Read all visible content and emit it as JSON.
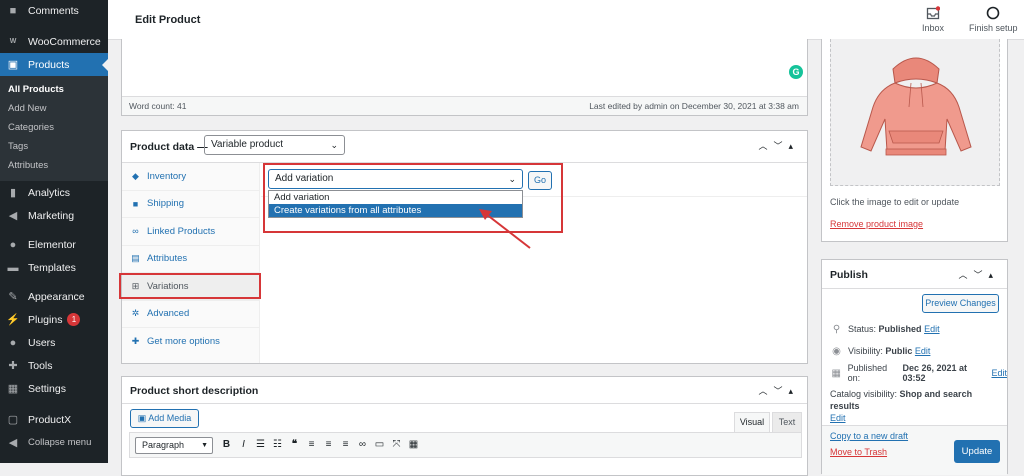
{
  "sidebar": {
    "items": [
      {
        "label": "Comments",
        "icon": "comment-icon"
      },
      {
        "label": "WooCommerce",
        "icon": "woo-icon"
      },
      {
        "label": "Products",
        "icon": "products-icon",
        "active": true
      },
      {
        "label": "Analytics",
        "icon": "chart-icon"
      },
      {
        "label": "Marketing",
        "icon": "megaphone-icon"
      },
      {
        "label": "Elementor",
        "icon": "elementor-icon"
      },
      {
        "label": "Templates",
        "icon": "folder-icon"
      },
      {
        "label": "Appearance",
        "icon": "brush-icon"
      },
      {
        "label": "Plugins",
        "icon": "plug-icon",
        "badge": "1"
      },
      {
        "label": "Users",
        "icon": "user-icon"
      },
      {
        "label": "Tools",
        "icon": "wrench-icon"
      },
      {
        "label": "Settings",
        "icon": "settings-icon"
      },
      {
        "label": "ProductX",
        "icon": "productx-icon"
      },
      {
        "label": "Collapse menu",
        "icon": "collapse-icon"
      }
    ],
    "submenu": [
      "All Products",
      "Add New",
      "Categories",
      "Tags",
      "Attributes"
    ]
  },
  "topbar": {
    "title": "Edit Product",
    "inbox_label": "Inbox",
    "finish_label": "Finish setup"
  },
  "editor": {
    "word_count": "Word count: 41",
    "last_edited": "Last edited by admin on December 30, 2021 at 3:38 am"
  },
  "product_data": {
    "title": "Product data —",
    "type_value": "Variable product",
    "tabs": [
      "Inventory",
      "Shipping",
      "Linked Products",
      "Attributes",
      "Variations",
      "Advanced",
      "Get more options"
    ],
    "variation_select": "Add variation",
    "go_label": "Go",
    "dropdown_options": [
      "Add variation",
      "Create variations from all attributes"
    ]
  },
  "short_desc": {
    "title": "Product short description",
    "add_media": "Add Media",
    "visual_tab": "Visual",
    "text_tab": "Text",
    "format_value": "Paragraph"
  },
  "product_image": {
    "hint": "Click the image to edit or update",
    "remove_link": "Remove product image"
  },
  "publish": {
    "title": "Publish",
    "preview_label": "Preview Changes",
    "status_label": "Status:",
    "status_value": "Published",
    "visibility_label": "Visibility:",
    "visibility_value": "Public",
    "published_label": "Published on:",
    "published_value": "Dec 26, 2021 at 03:52",
    "catalog_label": "Catalog visibility:",
    "catalog_value": "Shop and search results",
    "edit_label": "Edit",
    "copy_link": "Copy to a new draft",
    "trash_link": "Move to Trash",
    "update_label": "Update"
  },
  "colors": {
    "accent": "#2271b1",
    "highlight": "#d63638",
    "sidebar": "#1d2327"
  }
}
